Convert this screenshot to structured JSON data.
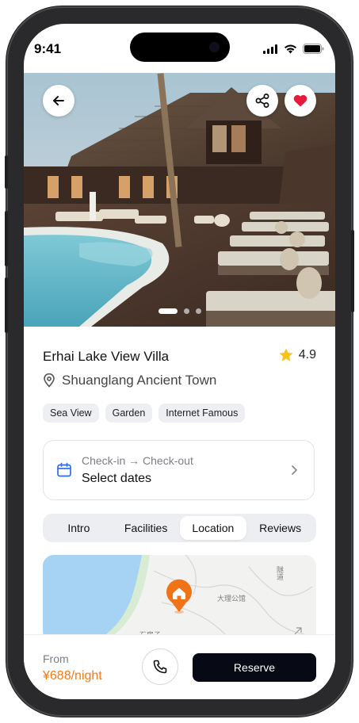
{
  "status_bar": {
    "time": "9:41"
  },
  "hero": {
    "back_icon": "arrow-left-icon",
    "share_icon": "share-icon",
    "favorite_icon": "heart-icon",
    "favorite_color": "#e8193c",
    "carousel": {
      "count": 3,
      "active": 1
    }
  },
  "listing": {
    "title": "Erhai Lake View Villa",
    "rating": "4.9",
    "location": "Shuanglang Ancient Town",
    "tags": [
      "Sea View",
      "Garden",
      "Internet Famous"
    ]
  },
  "dates": {
    "label": "Check-in → Check-out",
    "value": "Select dates"
  },
  "tabs": [
    {
      "label": "Intro",
      "active": false
    },
    {
      "label": "Facilities",
      "active": false
    },
    {
      "label": "Location",
      "active": true
    },
    {
      "label": "Reviews",
      "active": false
    }
  ],
  "map": {
    "labels": [
      "大理公馆",
      "隧道",
      "石房子"
    ],
    "pin_color": "#f07318"
  },
  "footer": {
    "from_label": "From",
    "price": "¥688/night",
    "price_color": "#f47a16",
    "reserve_label": "Reserve"
  }
}
